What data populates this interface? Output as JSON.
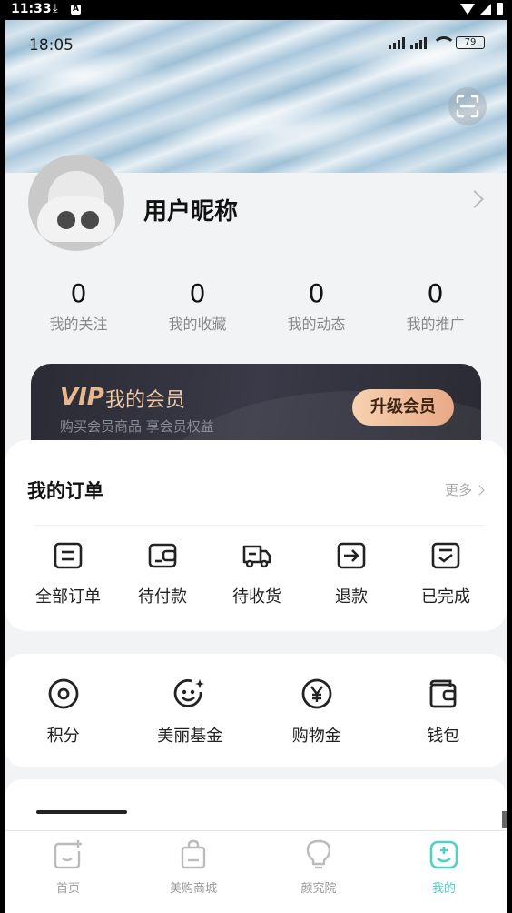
{
  "system_bar": {
    "time": "11:33",
    "download_icon": "download-icon",
    "app_icon_letter": "A"
  },
  "inner_status": {
    "time": "18:05",
    "battery": "79"
  },
  "profile": {
    "nickname": "用户昵称"
  },
  "stats": [
    {
      "value": "0",
      "label": "我的关注"
    },
    {
      "value": "0",
      "label": "我的收藏"
    },
    {
      "value": "0",
      "label": "我的动态"
    },
    {
      "value": "0",
      "label": "我的推广"
    }
  ],
  "vip": {
    "tag": "VIP",
    "title": "我的会员",
    "subtitle": "购买会员商品 享会员权益",
    "button": "升级会员"
  },
  "orders": {
    "title": "我的订单",
    "more": "更多",
    "items": [
      {
        "label": "全部订单",
        "icon": "all-orders-icon"
      },
      {
        "label": "待付款",
        "icon": "pending-payment-icon"
      },
      {
        "label": "待收货",
        "icon": "delivery-truck-icon"
      },
      {
        "label": "退款",
        "icon": "refund-icon"
      },
      {
        "label": "已完成",
        "icon": "completed-icon"
      }
    ]
  },
  "wallet": [
    {
      "label": "积分",
      "icon": "points-icon"
    },
    {
      "label": "美丽基金",
      "icon": "beauty-fund-icon"
    },
    {
      "label": "购物金",
      "icon": "yen-icon"
    },
    {
      "label": "钱包",
      "icon": "wallet-icon"
    }
  ],
  "tabs": [
    {
      "label": "首页",
      "icon": "home-icon",
      "active": false
    },
    {
      "label": "美购商城",
      "icon": "shopping-bag-icon",
      "active": false
    },
    {
      "label": "颜究院",
      "icon": "lightbulb-icon",
      "active": false
    },
    {
      "label": "我的",
      "icon": "profile-icon",
      "active": true
    }
  ],
  "colors": {
    "accent": "#4fd1c5",
    "vip_gold": "#f0c9a4",
    "vip_bg": "#2b2b35"
  }
}
